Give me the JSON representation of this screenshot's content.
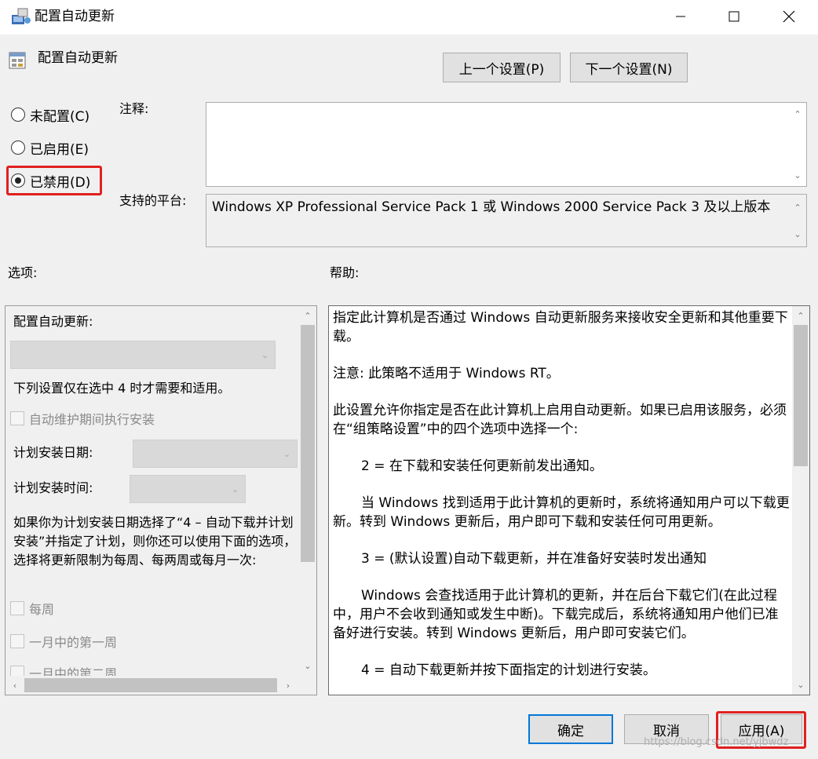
{
  "window": {
    "title": "配置自动更新"
  },
  "header": {
    "title": "配置自动更新"
  },
  "nav": {
    "prev_label": "上一个设置(P)",
    "next_label": "下一个设置(N)"
  },
  "state": {
    "options": [
      {
        "label": "未配置(C)",
        "checked": false
      },
      {
        "label": "已启用(E)",
        "checked": false
      },
      {
        "label": "已禁用(D)",
        "checked": true
      }
    ]
  },
  "comment": {
    "label": "注释:",
    "value": ""
  },
  "platform": {
    "label": "支持的平台:",
    "value": "Windows XP Professional Service Pack 1 或 Windows 2000 Service Pack 3 及以上版本"
  },
  "options_pane": {
    "label": "选项:",
    "configure_label": "配置自动更新:",
    "note": "下列设置仅在选中 4 时才需要和适用。",
    "maintenance_checkbox": "自动维护期间执行安装",
    "day_label": "计划安装日期:",
    "time_label": "计划安装时间:",
    "paragraph": "如果你为计划安装日期选择了“4 – 自动下载并计划安装”并指定了计划，则你还可以使用下面的选项，选择将更新限制为每周、每两周或每月一次:",
    "weekly": "每周",
    "first_week": "一月中的第一周",
    "second_week": "一月中的第二周"
  },
  "help_pane": {
    "label": "帮助:",
    "paragraphs": [
      "指定此计算机是否通过 Windows 自动更新服务来接收安全更新和其他重要下载。",
      "注意: 此策略不适用于 Windows RT。",
      "此设置允许你指定是否在此计算机上启用自动更新。如果已启用该服务，必须在“组策略设置”中的四个选项中选择一个:",
      "2 = 在下载和安装任何更新前发出通知。",
      "当 Windows 找到适用于此计算机的更新时，系统将通知用户可以下载更新。转到 Windows 更新后，用户即可下载和安装任何可用更新。",
      "3 = (默认设置)自动下载更新，并在准备好安装时发出通知",
      "Windows 会查找适用于此计算机的更新，并在后台下载它们(在此过程中，用户不会收到通知或发生中断)。下载完成后，系统将通知用户他们已准备好进行安装。转到 Windows 更新后，用户即可安装它们。",
      "4 = 自动下载更新并按下面指定的计划进行安装。"
    ]
  },
  "footer": {
    "ok_label": "确定",
    "cancel_label": "取消",
    "apply_label": "应用(A)"
  },
  "watermark": "https://blog.csdn.net/yjbwdz",
  "colors": {
    "highlight": "#e02020",
    "focus": "#0078d7"
  }
}
